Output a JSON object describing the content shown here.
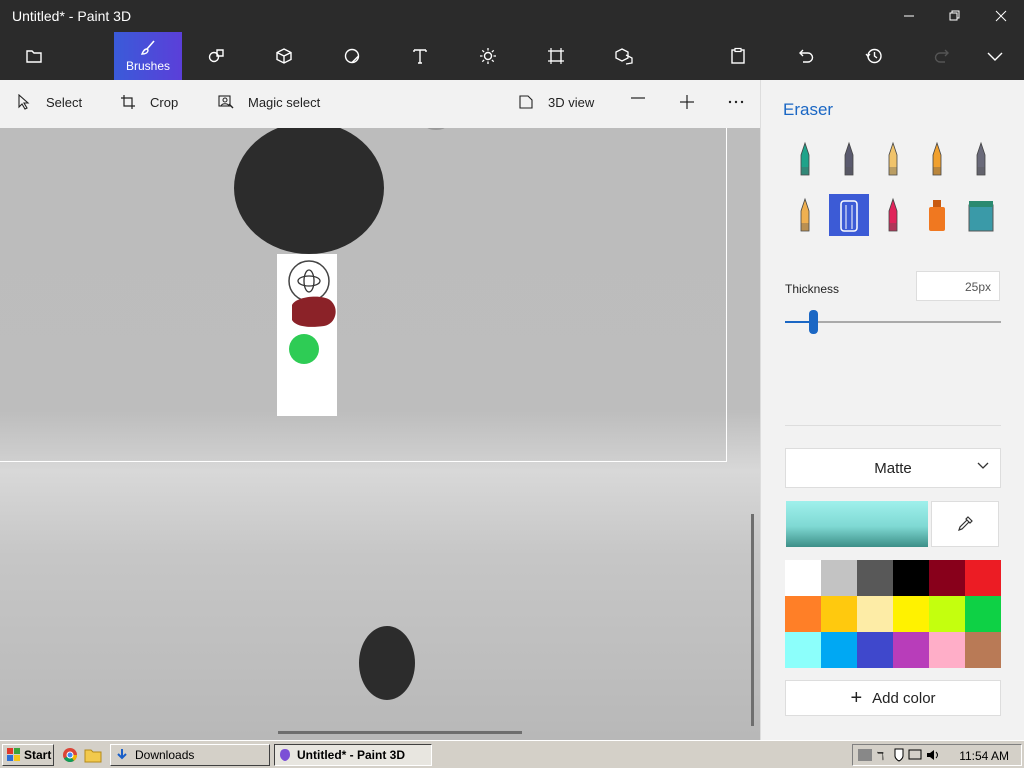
{
  "window": {
    "title": "Untitled* - Paint 3D"
  },
  "toolbar": {
    "tools": [
      {
        "name": "menu",
        "label": ""
      },
      {
        "name": "brushes",
        "label": "Brushes"
      },
      {
        "name": "2d-shapes",
        "label": ""
      },
      {
        "name": "3d-shapes",
        "label": ""
      },
      {
        "name": "stickers",
        "label": ""
      },
      {
        "name": "text",
        "label": ""
      },
      {
        "name": "effects",
        "label": ""
      },
      {
        "name": "canvas",
        "label": ""
      },
      {
        "name": "3d-library",
        "label": ""
      }
    ]
  },
  "subbar": {
    "select": "Select",
    "crop": "Crop",
    "magic_select": "Magic select",
    "view_3d": "3D view",
    "zoom_out": "—",
    "zoom_in": "+",
    "more": "⋯"
  },
  "panel": {
    "title": "Eraser",
    "thickness_label": "Thickness",
    "thickness_value": "25px",
    "thickness_fraction": 0.11,
    "finish": "Matte",
    "add_color": "Add color",
    "brushes": [
      {
        "name": "marker",
        "color": "#1fa38a"
      },
      {
        "name": "calligraphy-pen",
        "color": "#5a5a6e"
      },
      {
        "name": "oil-brush",
        "color": "#f0c36b"
      },
      {
        "name": "watercolor",
        "color": "#f0a02e"
      },
      {
        "name": "pixel-pen",
        "color": "#6a6a7a"
      },
      {
        "name": "pencil",
        "color": "#f0b050"
      },
      {
        "name": "eraser",
        "color": "#ffffff"
      },
      {
        "name": "crayon",
        "color": "#e0245a"
      },
      {
        "name": "spray-can",
        "color": "#f07820"
      },
      {
        "name": "fill",
        "color": "#3a9aa8"
      }
    ],
    "selected_brush": "eraser",
    "palette": [
      "#ffffff",
      "#c3c3c3",
      "#585858",
      "#000000",
      "#88001b",
      "#ec1c24",
      "#ff7f27",
      "#ffc90e",
      "#fdeca6",
      "#fff200",
      "#c4ff0e",
      "#0ed145",
      "#8cfffb",
      "#00a8f3",
      "#3f48cc",
      "#b83dba",
      "#ffaec8",
      "#b97a56"
    ]
  },
  "taskbar": {
    "start": "Start",
    "downloads": "Downloads",
    "active_window": "Untitled* - Paint 3D",
    "clock": "11:54 AM"
  }
}
